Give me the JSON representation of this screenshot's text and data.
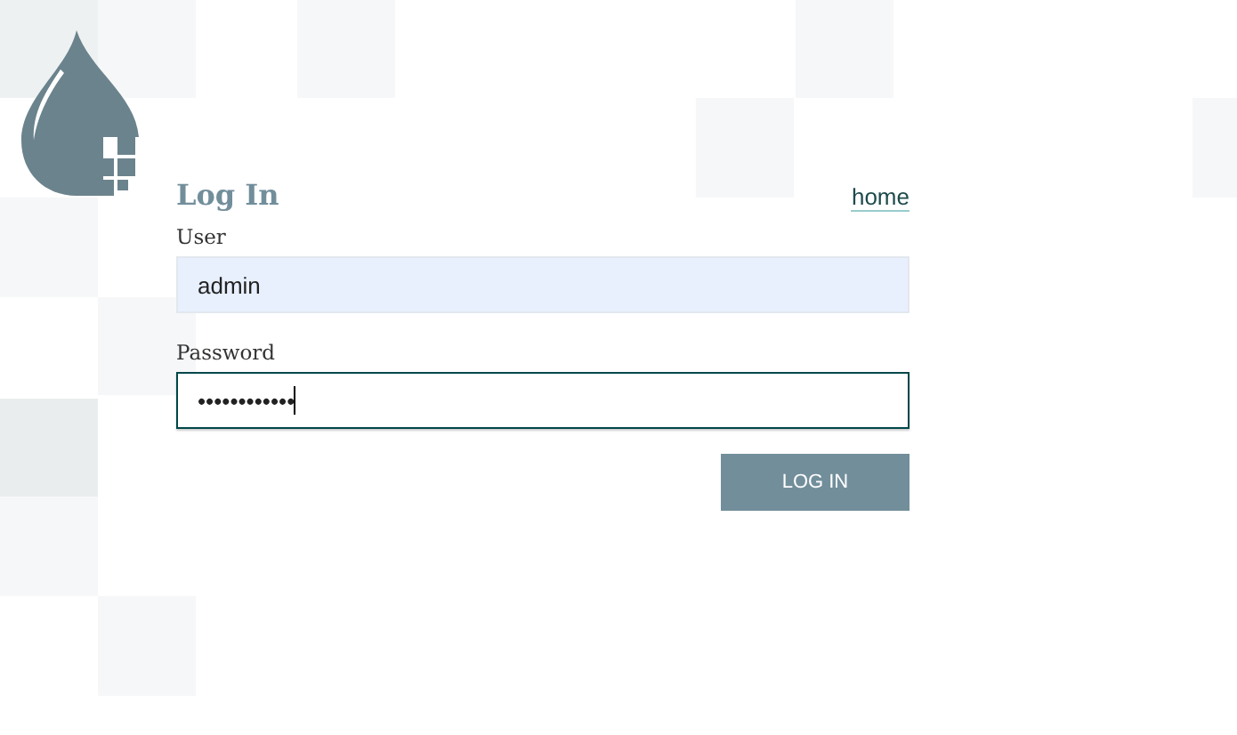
{
  "heading": "Log In",
  "home_link": "home",
  "fields": [
    {
      "label": "User",
      "value": "admin",
      "autofilled": true,
      "focused": false
    },
    {
      "label": "Password",
      "value": "••••••••••••",
      "autofilled": false,
      "focused": true
    }
  ],
  "submit_button": "LOG IN"
}
